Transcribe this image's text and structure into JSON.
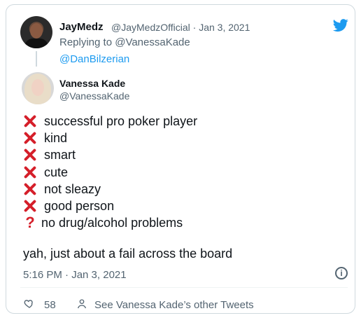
{
  "tweet": {
    "author_name": "JayMedz",
    "author_handle": "@JayMedzOfficial · Jan 3, 2021",
    "reply_prefix": "Replying to @VanessaKade",
    "mention": "@DanBilzerian",
    "brand_icon": "twitter-bird-icon",
    "accent_color": "#1d9bf0"
  },
  "quoted": {
    "name": "Vanessa Kade",
    "handle": "@VanessaKade"
  },
  "items": [
    {
      "icon": "cross-mark-icon",
      "text": "successful pro poker player"
    },
    {
      "icon": "cross-mark-icon",
      "text": "kind"
    },
    {
      "icon": "cross-mark-icon",
      "text": "smart"
    },
    {
      "icon": "cross-mark-icon",
      "text": "cute"
    },
    {
      "icon": "cross-mark-icon",
      "text": "not sleazy"
    },
    {
      "icon": "cross-mark-icon",
      "text": "good person"
    },
    {
      "icon": "question-mark-icon",
      "text": "no drug/alcohol problems"
    }
  ],
  "summary": "yah, just about a fail across the board",
  "meta": {
    "timestamp": "5:16 PM · Jan 3, 2021"
  },
  "footer": {
    "likes": "58",
    "other_tweets": "See Vanessa Kade’s other Tweets"
  }
}
